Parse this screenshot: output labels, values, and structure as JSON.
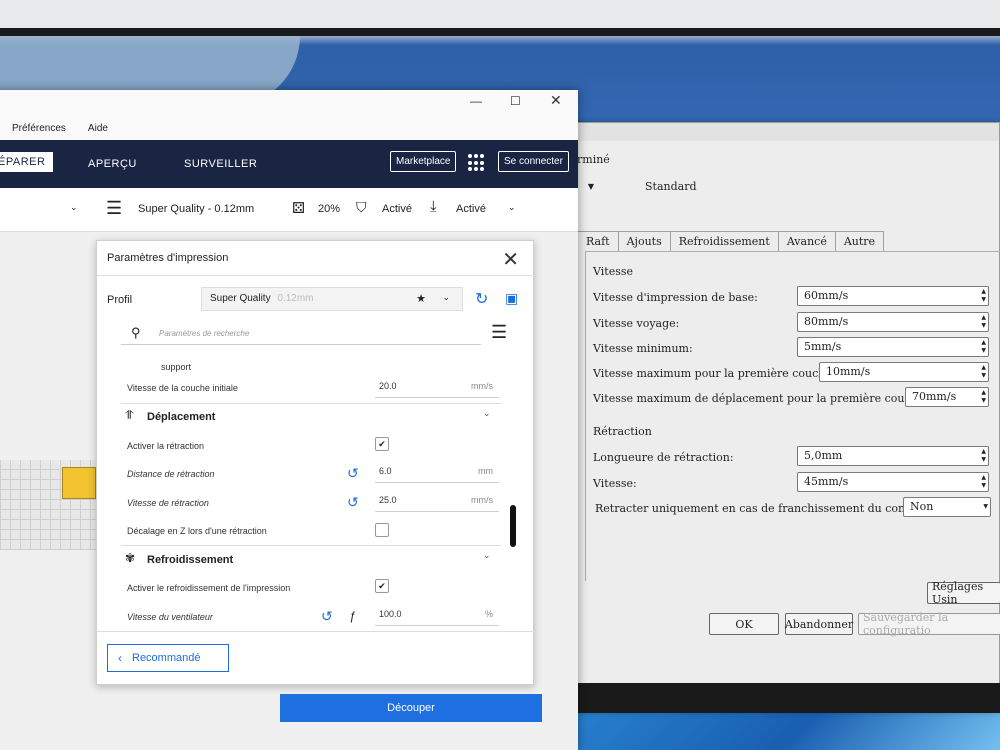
{
  "cura": {
    "menu": [
      "Préférences",
      "Aide"
    ],
    "stages": [
      "ÉPARER",
      "APERÇU",
      "SURVEILLER"
    ],
    "marketplace": "Marketplace",
    "signin": "Se connecter",
    "toolbar": {
      "profile": "Super Quality - 0.12mm",
      "infill": "20%",
      "support": "Activé",
      "adhesion": "Activé"
    },
    "slice_button": "Découper"
  },
  "print_settings": {
    "title": "Paramètres d'impression",
    "profile_label": "Profil",
    "profile_value": "Super Quality",
    "profile_suffix": "0.12mm",
    "search_placeholder": "Paramètres de recherche",
    "rows": {
      "support": "support",
      "initial_layer_speed_label": "Vitesse de la couche initiale",
      "initial_layer_speed_value": "20.0",
      "initial_layer_speed_unit": "mm/s",
      "travel_category": "Déplacement",
      "enable_retraction": "Activer la rétraction",
      "retraction_distance_label": "Distance de rétraction",
      "retraction_distance_value": "6.0",
      "retraction_distance_unit": "mm",
      "retraction_speed_label": "Vitesse de rétraction",
      "retraction_speed_value": "25.0",
      "retraction_speed_unit": "mm/s",
      "z_hop": "Décalage en Z lors d'une rétraction",
      "cooling_category": "Refroidissement",
      "enable_cooling": "Activer le refroidissement de l'impression",
      "fan_speed_label": "Vitesse du ventilateur",
      "fan_speed_value": "100.0",
      "fan_speed_unit": "%"
    },
    "recommended_button": "Recommandé"
  },
  "legacy": {
    "status_text": "rminé",
    "profile_select": "Standard",
    "tabs": [
      "Raft",
      "Ajouts",
      "Refroidissement",
      "Avancé",
      "Autre"
    ],
    "speed_section": "Vitesse",
    "speed_rows": [
      {
        "label": "Vitesse d'impression de base:",
        "value": "60mm/s"
      },
      {
        "label": "Vitesse voyage:",
        "value": "80mm/s"
      },
      {
        "label": "Vitesse minimum:",
        "value": "5mm/s"
      },
      {
        "label": "Vitesse maximum pour la première couche:",
        "value": "10mm/s"
      },
      {
        "label": "Vitesse maximum de déplacement pour la première couche:",
        "value": "70mm/s"
      }
    ],
    "retraction_section": "Rétraction",
    "retraction_rows": [
      {
        "label": "Longueure de rétraction:",
        "value": "5,0mm"
      },
      {
        "label": "Vitesse:",
        "value": "45mm/s"
      }
    ],
    "retract_only_label": "Retracter uniquement en cas de franchissement du contour:",
    "retract_only_value": "Non",
    "factory_button": "Réglages Usin",
    "ok_button": "OK",
    "cancel_button": "Abandonner",
    "save_button": "Sauvegarder la configuratio"
  }
}
